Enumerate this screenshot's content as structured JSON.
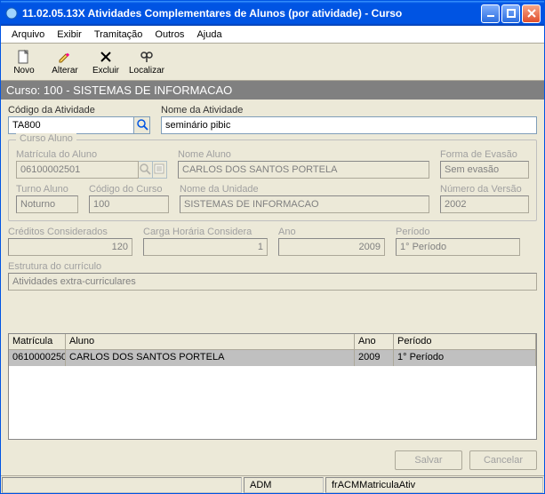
{
  "window": {
    "title": "11.02.05.13X Atividades Complementares de Alunos (por atividade) - Curso"
  },
  "menu": {
    "arquivo": "Arquivo",
    "exibir": "Exibir",
    "tramitacao": "Tramitação",
    "outros": "Outros",
    "ajuda": "Ajuda"
  },
  "toolbar": {
    "novo": "Novo",
    "alterar": "Alterar",
    "excluir": "Excluir",
    "localizar": "Localizar"
  },
  "banner": {
    "text": "Curso: 100 - SISTEMAS DE INFORMACAO"
  },
  "activity": {
    "codigo_label": "Código da Atividade",
    "codigo_value": "TA800",
    "nome_label": "Nome da Atividade",
    "nome_value": "seminário pibic"
  },
  "curso_aluno": {
    "legend": "Curso Aluno",
    "matricula_label": "Matrícula do Aluno",
    "matricula_value": "06100002501",
    "nome_aluno_label": "Nome Aluno",
    "nome_aluno_value": "CARLOS DOS SANTOS PORTELA",
    "forma_evasao_label": "Forma de Evasão",
    "forma_evasao_value": "Sem evasão",
    "turno_label": "Turno Aluno",
    "turno_value": "Noturno",
    "cod_curso_label": "Código do Curso",
    "cod_curso_value": "100",
    "nome_unidade_label": "Nome da Unidade",
    "nome_unidade_value": "SISTEMAS DE INFORMACAO",
    "num_versao_label": "Número da Versão",
    "num_versao_value": "2002"
  },
  "infos": {
    "creditos_label": "Créditos Considerados",
    "creditos_value": "120",
    "carga_label": "Carga Horária Considera",
    "carga_value": "1",
    "ano_label": "Ano",
    "ano_value": "2009",
    "periodo_label": "Período",
    "periodo_value": "1° Período"
  },
  "estrutura": {
    "label": "Estrutura do currículo",
    "value": "Atividades extra-curriculares"
  },
  "table": {
    "headers": [
      "Matrícula",
      "Aluno",
      "Ano",
      "Período"
    ],
    "rows": [
      {
        "matricula": "0610000250",
        "aluno": "CARLOS DOS SANTOS PORTELA",
        "ano": "2009",
        "periodo": "1° Período"
      }
    ]
  },
  "buttons": {
    "salvar": "Salvar",
    "cancelar": "Cancelar"
  },
  "status": {
    "user": "ADM",
    "form": "frACMMatriculaAtiv"
  }
}
